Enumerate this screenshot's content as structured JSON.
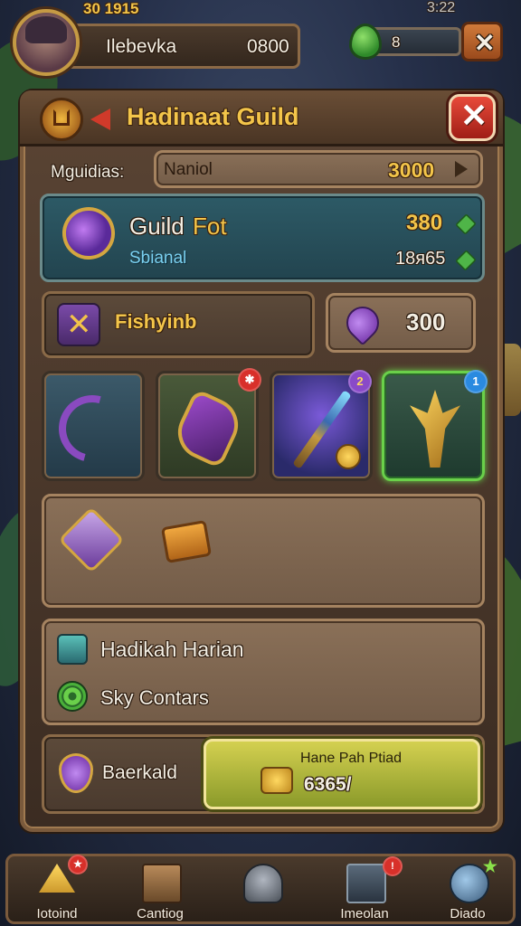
{
  "top_bar": {
    "top_value": "30 1915",
    "top_right_value": "3:22",
    "player_name": "Ilebevka",
    "player_score": "0800",
    "gem_count": "8"
  },
  "panel": {
    "title": "Hadinaat Guild",
    "search_label": "Mguidias:",
    "search_value": "Naniol",
    "search_amount": "3000",
    "guild_fort": {
      "title_a": "Guild",
      "title_b": "Fot",
      "subtitle": "Sbianal",
      "value_1": "380",
      "value_2": "18ᴙ65"
    },
    "feature": {
      "label": "Fishyinb",
      "cost": "300"
    },
    "items": [
      {
        "name": "curved-blade",
        "badge": ""
      },
      {
        "name": "claw-gauntlet",
        "badge": "✱"
      },
      {
        "name": "crystal-staff",
        "badge": "2"
      },
      {
        "name": "golden-trident",
        "badge": "1"
      }
    ],
    "rows": [
      {
        "label": "Hadikah Harian"
      },
      {
        "label": "Sky Contars"
      }
    ],
    "bottom": {
      "label": "Baerkald",
      "action_label": "Hane Pah Ptiad",
      "action_value": "6365/"
    }
  },
  "bottom_nav": [
    {
      "label": "Iotoind"
    },
    {
      "label": "Cantiog"
    },
    {
      "label": ""
    },
    {
      "label": "Imeolan"
    },
    {
      "label": "Diado"
    }
  ]
}
